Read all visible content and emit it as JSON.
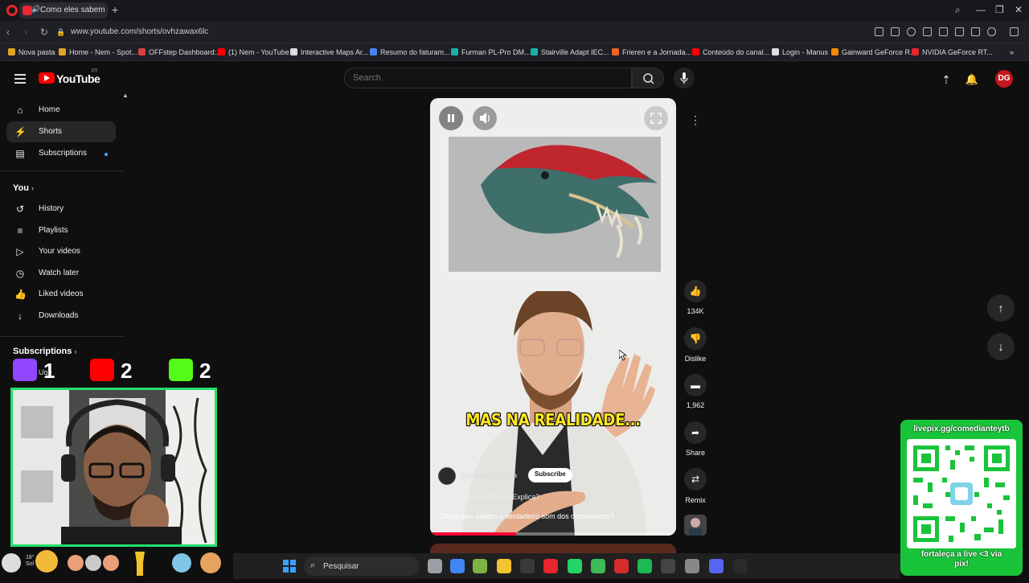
{
  "browser": {
    "tab_title": "Como eles sabem o ve",
    "url": "www.youtube.com/shorts/ovhzawax6lc",
    "bookmarks": [
      {
        "label": "Nova pasta",
        "color": "#e0a526"
      },
      {
        "label": "Home - Nem - Spot...",
        "color": "#e0a526"
      },
      {
        "label": "OFFstep Dashboard:...",
        "color": "#d84040"
      },
      {
        "label": "(1) Nem - YouTube",
        "color": "#ff0000"
      },
      {
        "label": "Interactive Maps Ar...",
        "color": "#dddddd"
      },
      {
        "label": "Resumo do faturam...",
        "color": "#4285f4"
      },
      {
        "label": "Furman PL-Pro DM...",
        "color": "#16b3a6"
      },
      {
        "label": "Stairville Adapt IEC...",
        "color": "#16b3a6"
      },
      {
        "label": "Frieren e a Jornada...",
        "color": "#f26522"
      },
      {
        "label": "Conteúdo do canal...",
        "color": "#ff0000"
      },
      {
        "label": "Login - Manus",
        "color": "#dddddd"
      },
      {
        "label": "Gainward GeForce R...",
        "color": "#f28c00"
      },
      {
        "label": "NVIDIA GeForce RT...",
        "color": "#e8262d"
      }
    ]
  },
  "header": {
    "logo_text": "YouTube",
    "logo_country": "PT",
    "search_placeholder": "Search",
    "avatar_initials": "DG"
  },
  "sidebar": {
    "items": [
      {
        "label": "Home",
        "icon": "home-icon",
        "glyph": "⌂"
      },
      {
        "label": "Shorts",
        "icon": "shorts-icon",
        "glyph": "⚡"
      },
      {
        "label": "Subscriptions",
        "icon": "subscriptions-icon",
        "glyph": "▤"
      }
    ],
    "you_heading": "You",
    "you_items": [
      {
        "label": "History",
        "icon": "history-icon",
        "glyph": "↺"
      },
      {
        "label": "Playlists",
        "icon": "playlists-icon",
        "glyph": "≡"
      },
      {
        "label": "Your videos",
        "icon": "your-videos-icon",
        "glyph": "▷"
      },
      {
        "label": "Watch later",
        "icon": "watch-later-icon",
        "glyph": "◷"
      },
      {
        "label": "Liked videos",
        "icon": "liked-videos-icon",
        "glyph": "👍"
      },
      {
        "label": "Downloads",
        "icon": "downloads-icon",
        "glyph": "↓"
      }
    ],
    "subscriptions_heading": "Subscriptions",
    "sub_item_partial": "Uqu"
  },
  "stream_overlay": {
    "counters": [
      {
        "platform": "twitch",
        "value": "1",
        "color": "#9146ff"
      },
      {
        "platform": "youtube",
        "value": "2",
        "color": "#ff0000"
      },
      {
        "platform": "kick",
        "value": "2",
        "color": "#53fc18"
      }
    ],
    "qr_url": "livepix.gg/comedianteytb",
    "qr_footer_line1": "fortaleça a live <3 via",
    "qr_footer_line2": "pix!",
    "accent": "#19c43a"
  },
  "short": {
    "caption": "MAS NA REALIDADE...",
    "channel": "@antoniomiranda",
    "subscribe": "Subscribe",
    "playlist": "Será que a Ciência Explica?",
    "title": "Como eles sabem o verdadeiro som dos dinossauros?",
    "progress": 0.35
  },
  "actions": {
    "likes": "134K",
    "dislike": "Dislike",
    "comments": "1,962",
    "share": "Share",
    "remix": "Remix"
  },
  "taskbar": {
    "weather_temp": "18°",
    "weather_text": "Sol",
    "search_label": "Pesquisar",
    "apps": [
      {
        "name": "task-view",
        "color": "#9aa0a6"
      },
      {
        "name": "chrome",
        "color": "#4285f4"
      },
      {
        "name": "charts-app",
        "color": "#7cb342"
      },
      {
        "name": "file-explorer",
        "color": "#f4c430"
      },
      {
        "name": "store",
        "color": "#3a3a3a"
      },
      {
        "name": "opera",
        "color": "#e8262d"
      },
      {
        "name": "whatsapp",
        "color": "#25d366"
      },
      {
        "name": "shield-app",
        "color": "#3cba54"
      },
      {
        "name": "adobe-app",
        "color": "#d42c2c"
      },
      {
        "name": "spotify",
        "color": "#1db954"
      },
      {
        "name": "sound-app",
        "color": "#444444"
      },
      {
        "name": "settings-app",
        "color": "#888888"
      },
      {
        "name": "discord",
        "color": "#5865f2"
      },
      {
        "name": "obs",
        "color": "#2a2a2a"
      }
    ]
  }
}
